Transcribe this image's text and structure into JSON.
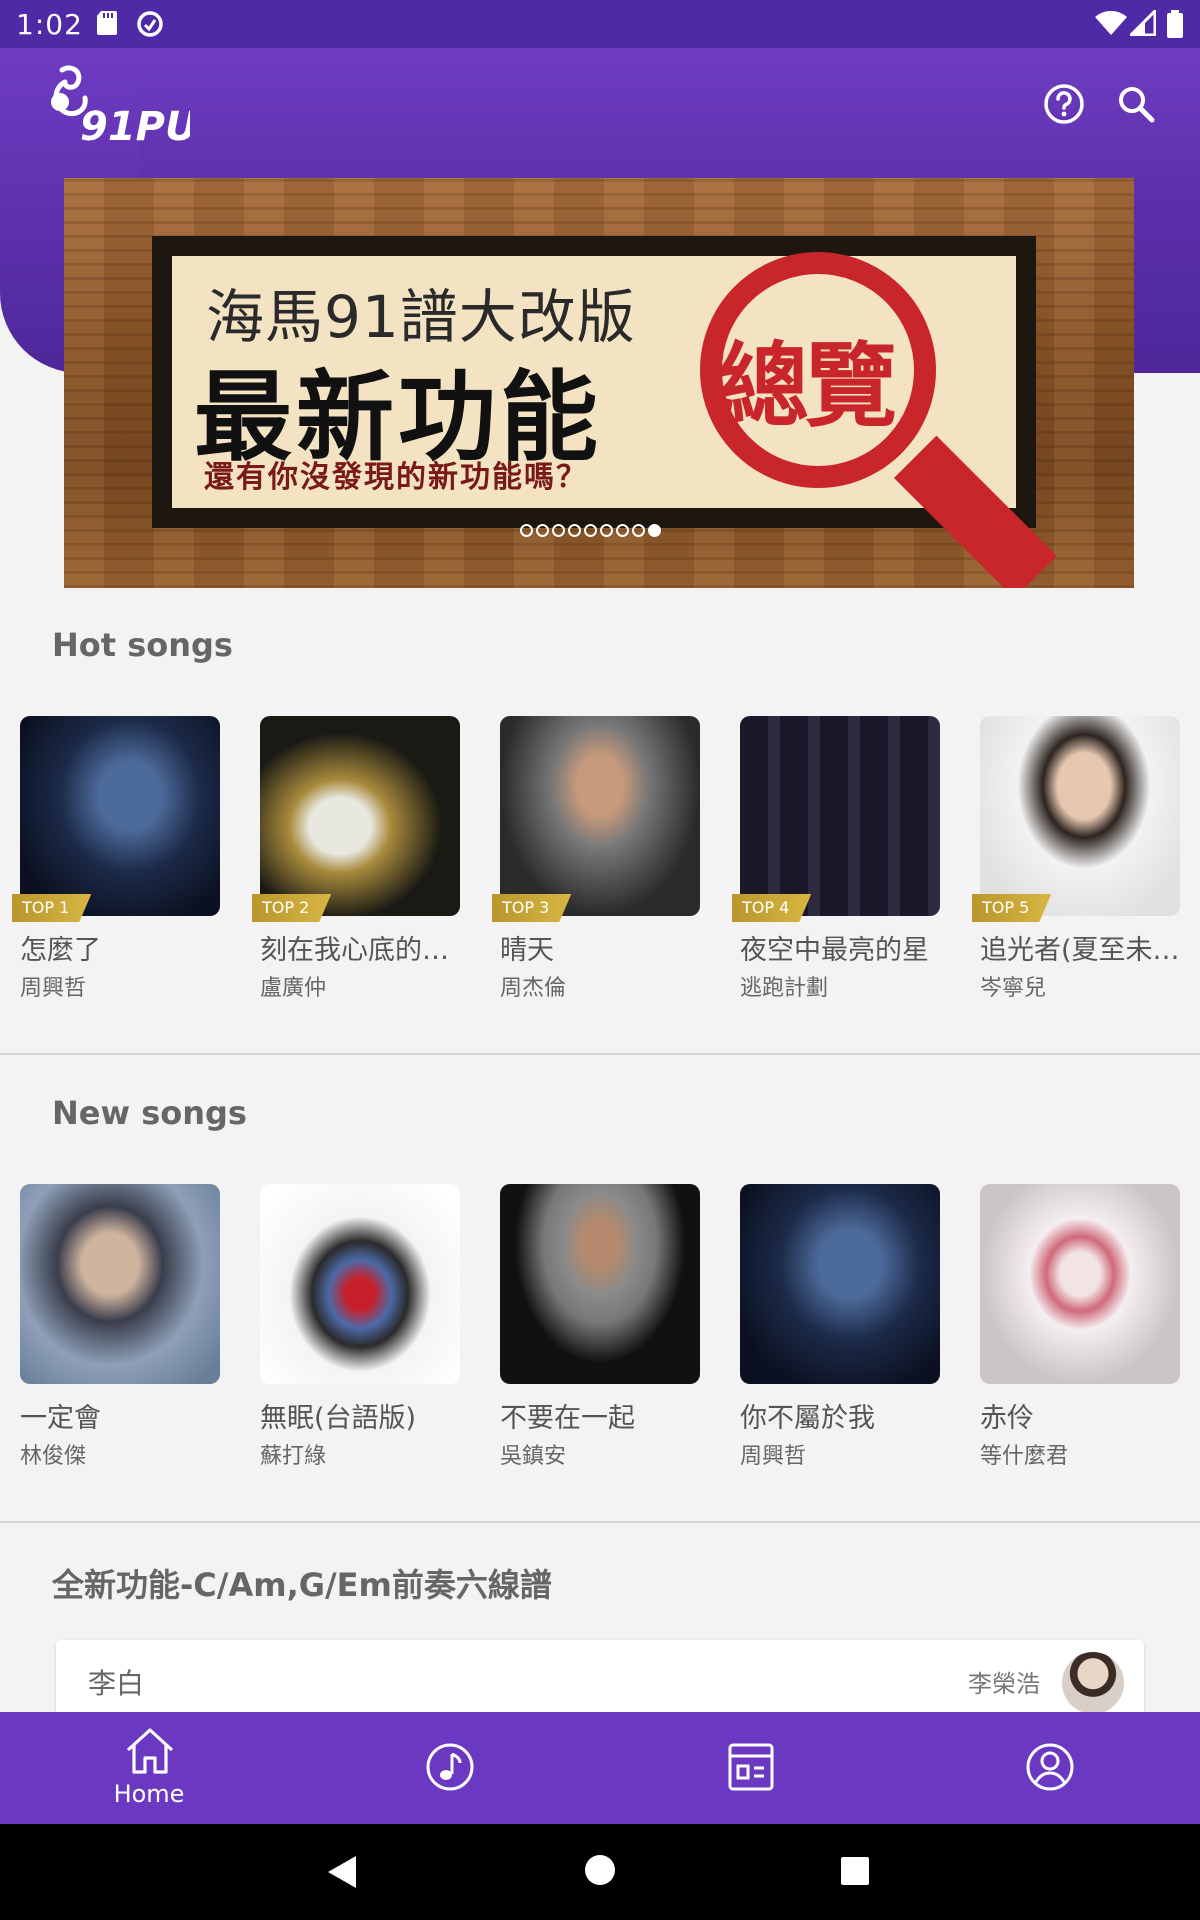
{
  "status_bar": {
    "time": "1:02"
  },
  "brand": {
    "logo_text": "91PU"
  },
  "banner": {
    "line1": "海馬91譜大改版",
    "line2": "最新功能",
    "line3": "還有你沒發現的新功能嗎？",
    "highlight": "總覽",
    "dot_count": 9,
    "active_dot": 8
  },
  "hot_songs": {
    "title": "Hot songs",
    "items": [
      {
        "rank": "TOP 1",
        "title": "怎麼了",
        "artist": "周興哲"
      },
      {
        "rank": "TOP 2",
        "title": "刻在我心底的…",
        "artist": "盧廣仲"
      },
      {
        "rank": "TOP 3",
        "title": "晴天",
        "artist": "周杰倫"
      },
      {
        "rank": "TOP 4",
        "title": "夜空中最亮的星",
        "artist": "逃跑計劃"
      },
      {
        "rank": "TOP 5",
        "title": "追光者(夏至未…",
        "artist": "岑寧兒"
      }
    ]
  },
  "new_songs": {
    "title": "New songs",
    "items": [
      {
        "title": "一定會",
        "artist": "林俊傑"
      },
      {
        "title": "無眠(台語版)",
        "artist": "蘇打綠"
      },
      {
        "title": "不要在一起",
        "artist": "吳鎮安"
      },
      {
        "title": "你不屬於我",
        "artist": "周興哲"
      },
      {
        "title": "赤伶",
        "artist": "等什麼君"
      }
    ]
  },
  "feature": {
    "title": "全新功能-C/Am,G/Em前奏六線譜",
    "song": "李白",
    "artist": "李榮浩"
  },
  "bottom_nav": {
    "home_label": "Home"
  },
  "colors": {
    "primary": "#6b38c2",
    "status": "#4f2aa6",
    "rank_tag": "#c9a93b"
  }
}
